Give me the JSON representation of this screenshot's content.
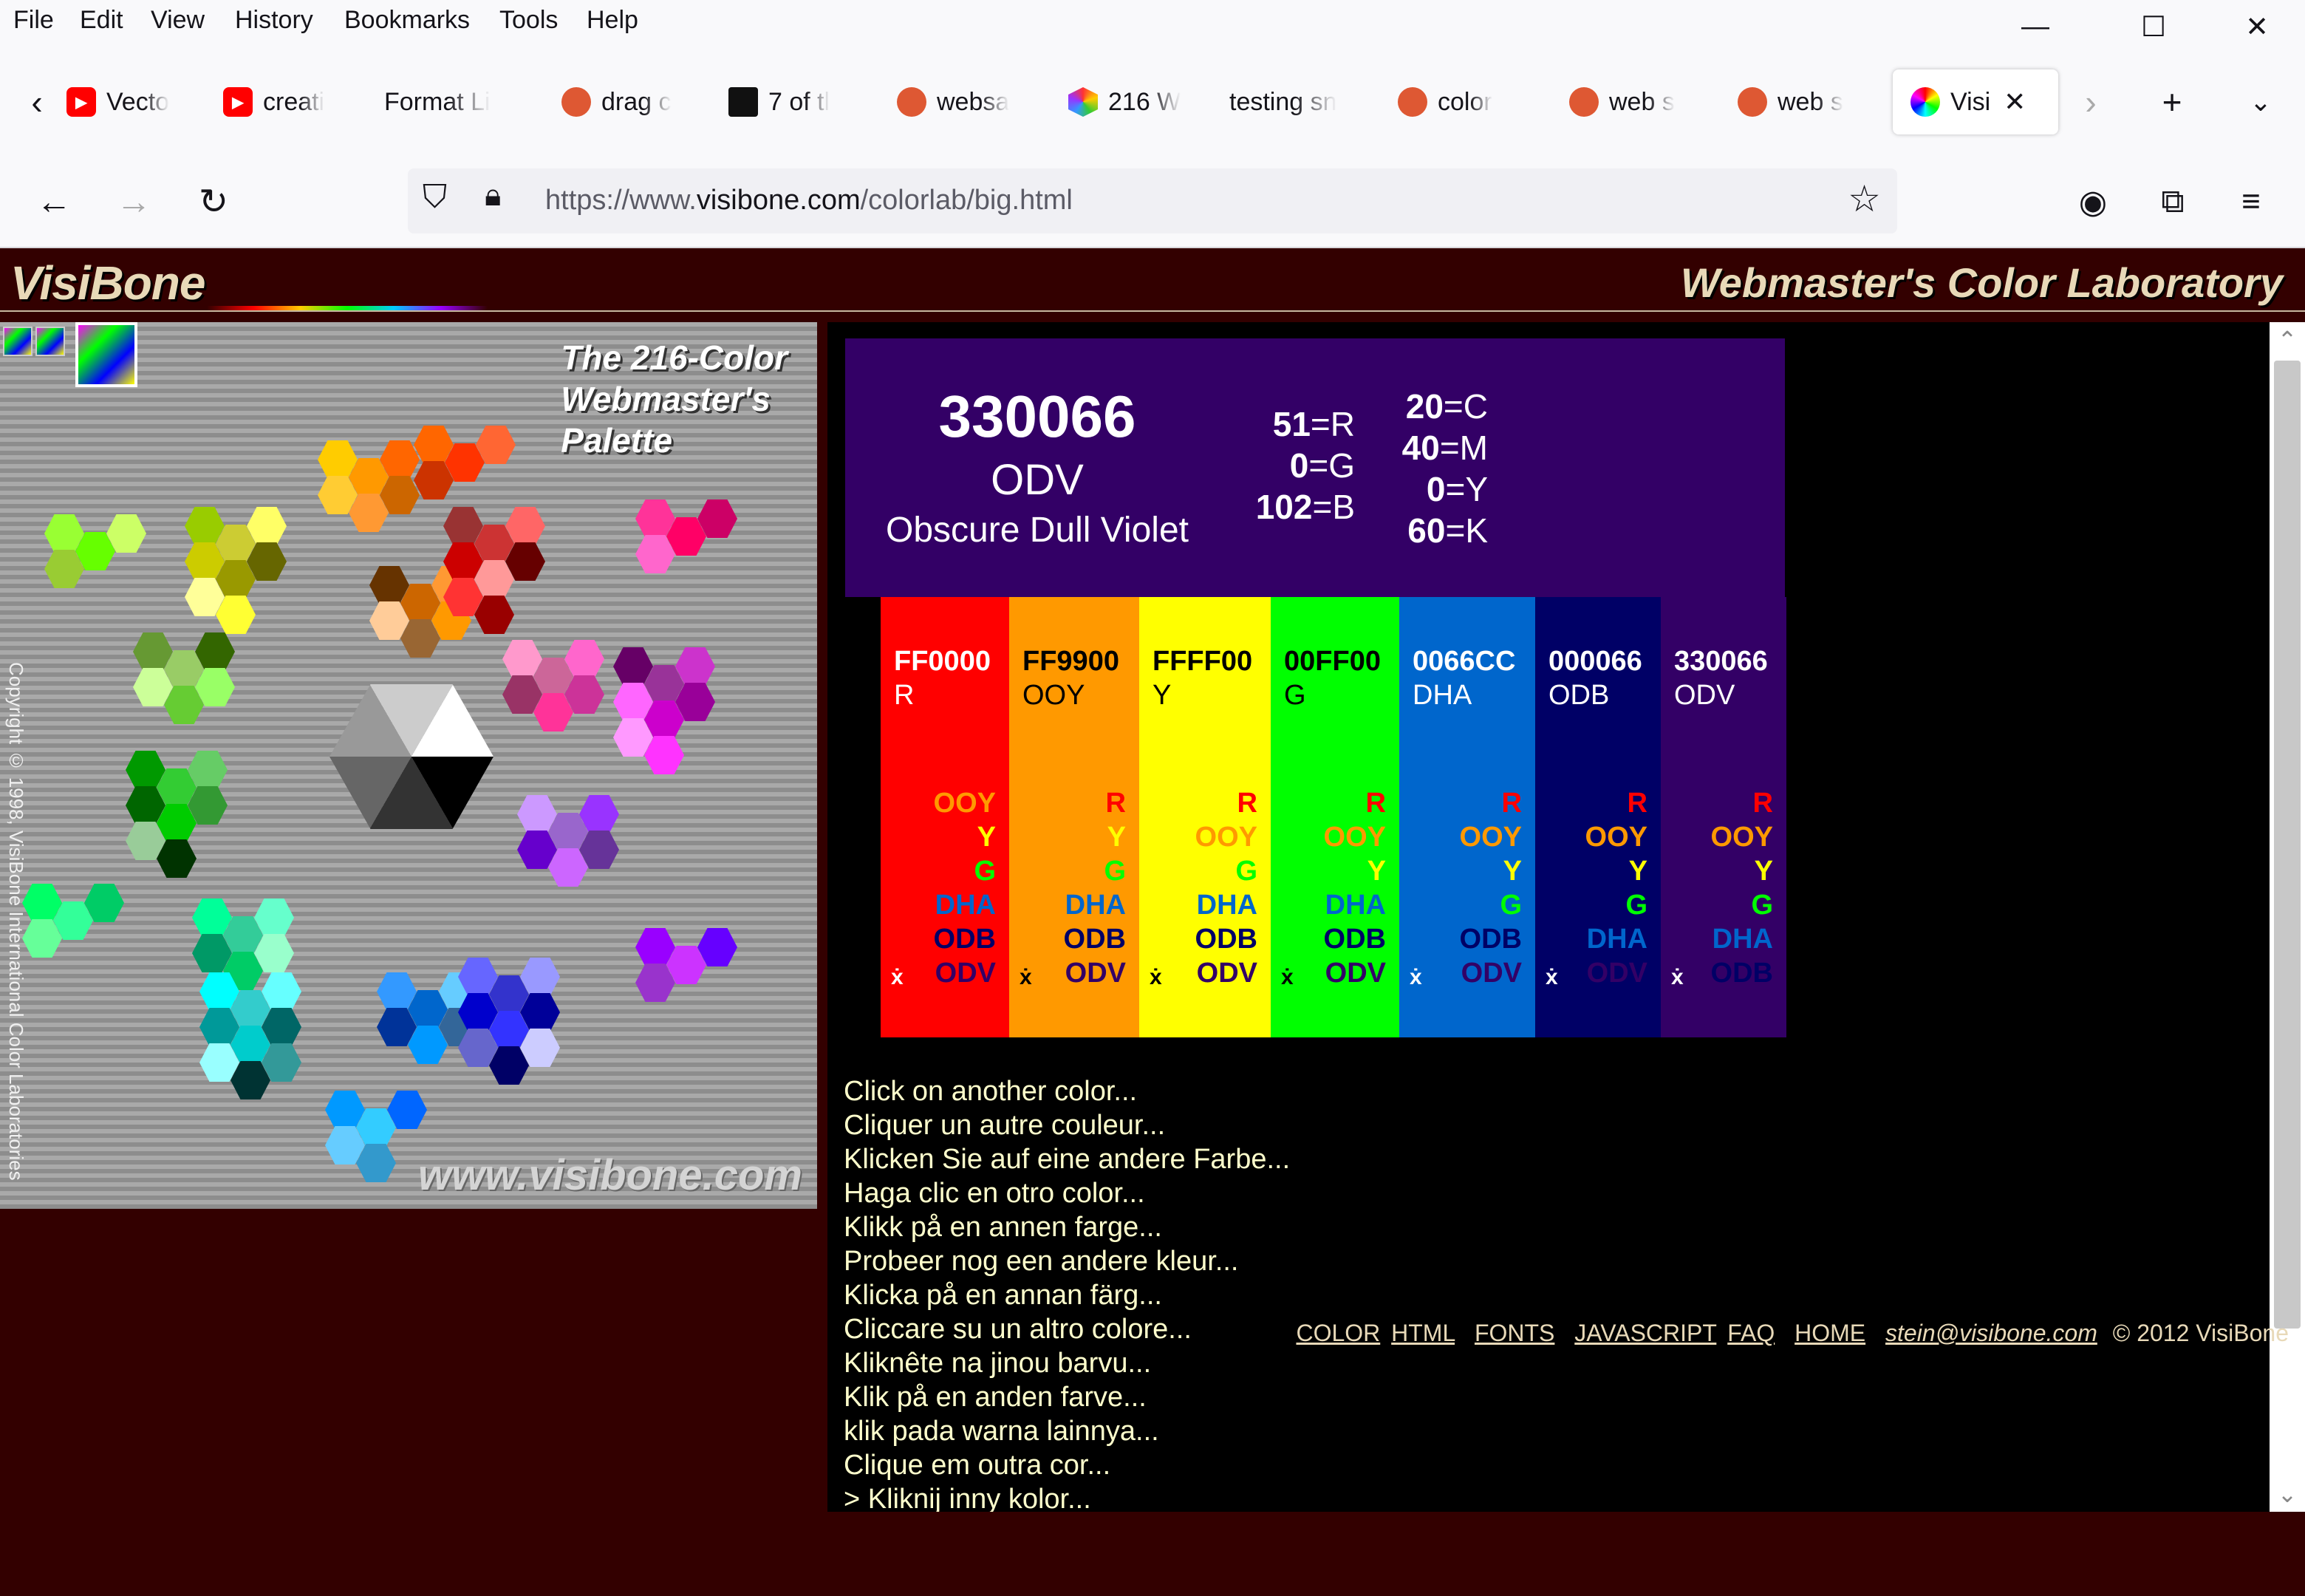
{
  "browser": {
    "menu": [
      "File",
      "Edit",
      "View",
      "History",
      "Bookmarks",
      "Tools",
      "Help"
    ],
    "tabs": [
      {
        "label": "Vecto",
        "icon": "youtube-icon",
        "color": "#ff0000"
      },
      {
        "label": "creati",
        "icon": "youtube-icon",
        "color": "#ff0000"
      },
      {
        "label": "Format Li",
        "icon": "",
        "color": ""
      },
      {
        "label": "drag c",
        "icon": "duckduckgo-icon",
        "color": "#de5833"
      },
      {
        "label": "7 of tl",
        "icon": "site-icon",
        "color": "#111111"
      },
      {
        "label": "websa",
        "icon": "duckduckgo-icon",
        "color": "#de5833"
      },
      {
        "label": "216 W",
        "icon": "hexagon-icon",
        "color": "#3399cc"
      },
      {
        "label": "testing sn",
        "icon": "",
        "color": ""
      },
      {
        "label": "color",
        "icon": "duckduckgo-icon",
        "color": "#de5833"
      },
      {
        "label": "web s",
        "icon": "duckduckgo-icon",
        "color": "#de5833"
      },
      {
        "label": "web s",
        "icon": "duckduckgo-icon",
        "color": "#de5833"
      },
      {
        "label": "Visi",
        "icon": "visibone-icon",
        "color": "#9933cc",
        "active": true
      }
    ],
    "url_prefix": "https://www.",
    "url_host": "visibone.com",
    "url_path": "/colorlab/big.html"
  },
  "page": {
    "logo": "VisiBone",
    "lab_title": "Webmaster's Color Laboratory",
    "palette_title": [
      "The 216-Color",
      "Webmaster's",
      "Palette"
    ],
    "palette_url": "www.visibone.com",
    "palette_copyright": "Copyright © 1998, VisiBone International Color Laboratories"
  },
  "color_info": {
    "hex": "330066",
    "abbr": "ODV",
    "name": "Obscure Dull Violet",
    "background": "#330066",
    "rgb": [
      {
        "value": "51",
        "label": "=R"
      },
      {
        "value": "0",
        "label": "=G"
      },
      {
        "value": "102",
        "label": "=B"
      }
    ],
    "cmyk": [
      {
        "value": "20",
        "label": "=C"
      },
      {
        "value": "40",
        "label": "=M"
      },
      {
        "value": "0",
        "label": "=Y"
      },
      {
        "value": "60",
        "label": "=K"
      }
    ]
  },
  "swatches": [
    {
      "hex": "FF0000",
      "abbr": "R",
      "bg": "#ff0000",
      "fg": "#ffffff",
      "width": 174
    },
    {
      "hex": "FF9900",
      "abbr": "OOY",
      "bg": "#ff9900",
      "fg": "#000000",
      "width": 176
    },
    {
      "hex": "FFFF00",
      "abbr": "Y",
      "bg": "#ffff00",
      "fg": "#000000",
      "width": 178
    },
    {
      "hex": "00FF00",
      "abbr": "G",
      "bg": "#00ff00",
      "fg": "#000000",
      "width": 174
    },
    {
      "hex": "0066CC",
      "abbr": "DHA",
      "bg": "#0066cc",
      "fg": "#ffffff",
      "width": 184
    },
    {
      "hex": "000066",
      "abbr": "ODB",
      "bg": "#000066",
      "fg": "#ffffff",
      "width": 170
    },
    {
      "hex": "330066",
      "abbr": "ODV",
      "bg": "#330066",
      "fg": "#ffffff",
      "width": 170
    }
  ],
  "relatives": [
    {
      "label": "R",
      "color": "#ff0000"
    },
    {
      "label": "OOY",
      "color": "#ff9900"
    },
    {
      "label": "Y",
      "color": "#ffff00"
    },
    {
      "label": "G",
      "color": "#00ff00"
    },
    {
      "label": "DHA",
      "color": "#0066cc"
    },
    {
      "label": "ODB",
      "color": "#000066"
    },
    {
      "label": "ODV",
      "color": "#330066"
    }
  ],
  "messages": [
    "Click on another color...",
    "Cliquer un autre couleur...",
    "Klicken Sie auf eine andere Farbe...",
    "Haga clic en otro color...",
    "Klikk på en annen farge...",
    "Probeer nog een andere kleur...",
    "Klicka på en annan färg...",
    "Cliccare su un altro colore...",
    "Kliknête na jinou barvu...",
    "Klik på en anden farve...",
    "klik pada warna lainnya...",
    "Clique em outra cor...",
    "> Kliknij inny kolor..."
  ],
  "footer": {
    "links": [
      "COLOR",
      "HTML",
      "FONTS",
      "JAVASCRIPT",
      "FAQ",
      "HOME"
    ],
    "email": "stein@visibone.com",
    "copyright": "© 2012 VisiBone"
  }
}
